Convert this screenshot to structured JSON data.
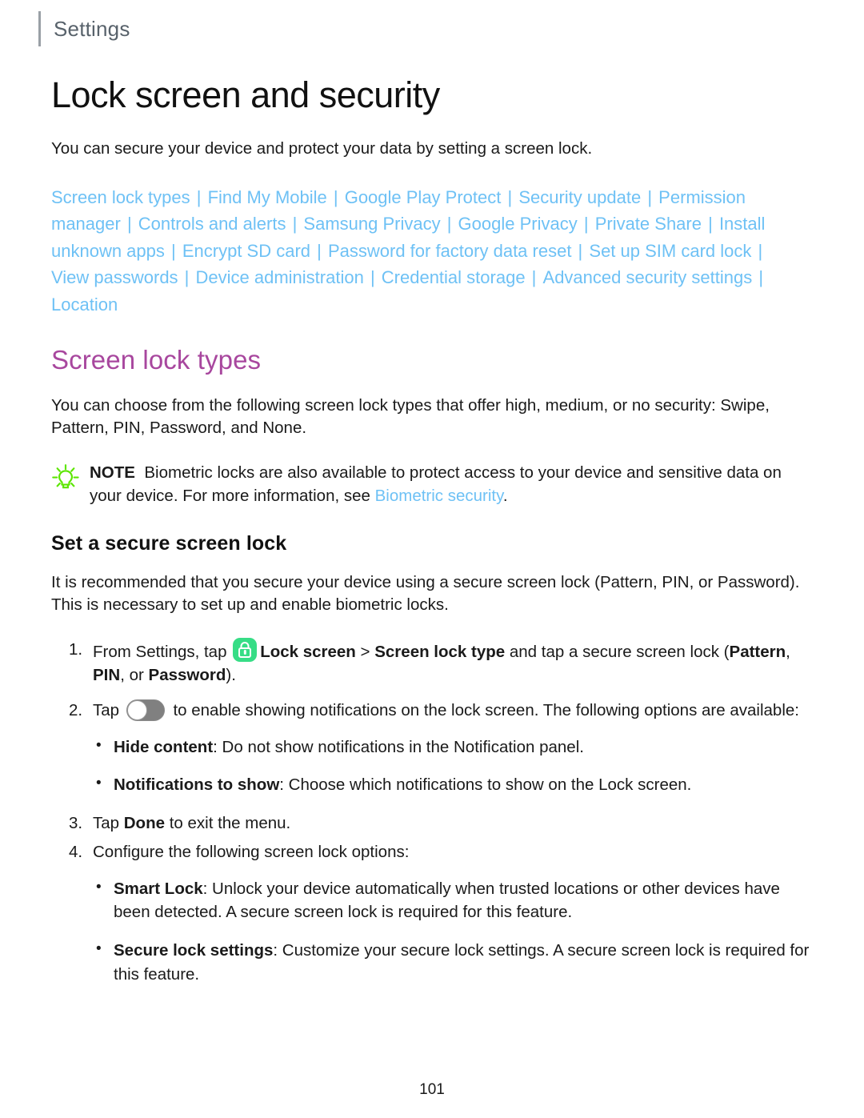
{
  "header": {
    "title": "Settings"
  },
  "page": {
    "title": "Lock screen and security",
    "intro": "You can secure your device and protect your data by setting a screen lock.",
    "page_number": "101"
  },
  "link_list": {
    "separator": "|",
    "links": [
      "Screen lock types",
      "Find My Mobile",
      "Google Play Protect",
      "Security update",
      "Permission manager",
      "Controls and alerts",
      "Samsung Privacy",
      "Google Privacy",
      "Private Share",
      "Install unknown apps",
      "Encrypt SD card",
      "Password for factory data reset",
      "Set up SIM card lock",
      "View passwords",
      "Device administration",
      "Credential storage",
      "Advanced security settings",
      "Location"
    ],
    "trailing_separator": true
  },
  "section": {
    "heading": "Screen lock types",
    "body": "You can choose from the following screen lock types that offer high, medium, or no security: Swipe, Pattern, PIN, Password, and None."
  },
  "note": {
    "icon": "lightbulb-icon",
    "label": "NOTE",
    "text_before_link": "Biometric locks are also available to protect access to your device and sensitive data on your device. For more information, see ",
    "link": "Biometric security",
    "text_after_link": "."
  },
  "subsection": {
    "heading": "Set a secure screen lock",
    "body": "It is recommended that you secure your device using a secure screen lock (Pattern, PIN, or Password). This is necessary to set up and enable biometric locks."
  },
  "steps": {
    "step1": {
      "prefix": "From Settings, tap ",
      "icon": "lock-app-icon",
      "bold1": "Lock screen",
      "chevron": ">",
      "bold2": "Screen lock type",
      "middle": " and tap a secure screen lock (",
      "bold3": "Pattern",
      "comma1": ", ",
      "bold4": "PIN",
      "middle2": ", or ",
      "bold5": "Password",
      "suffix": ")."
    },
    "step2": {
      "prefix": "Tap ",
      "icon": "notification-toggle",
      "suffix": " to enable showing notifications on the lock screen. The following options are available:"
    },
    "step2_bullets": [
      {
        "label": "Hide content",
        "text": ": Do not show notifications in the Notification panel."
      },
      {
        "label": "Notifications to show",
        "text": ": Choose which notifications to show on the Lock screen."
      }
    ],
    "step3": {
      "prefix": "Tap ",
      "bold": "Done",
      "suffix": " to exit the menu."
    },
    "step4": {
      "text": "Configure the following screen lock options:"
    },
    "step4_bullets": [
      {
        "label": "Smart Lock",
        "text": ": Unlock your device automatically when trusted locations or other devices have been detected. A secure screen lock is required for this feature."
      },
      {
        "label": "Secure lock settings",
        "text": ": Customize your secure lock settings. A secure screen lock is required for this feature."
      }
    ]
  },
  "colors": {
    "link": "#6ec1f5",
    "section_heading": "#a8479e",
    "note_icon": "#5ce600",
    "lock_icon": "#37dd86",
    "toggle": "#808080",
    "header_text": "#58626b"
  }
}
